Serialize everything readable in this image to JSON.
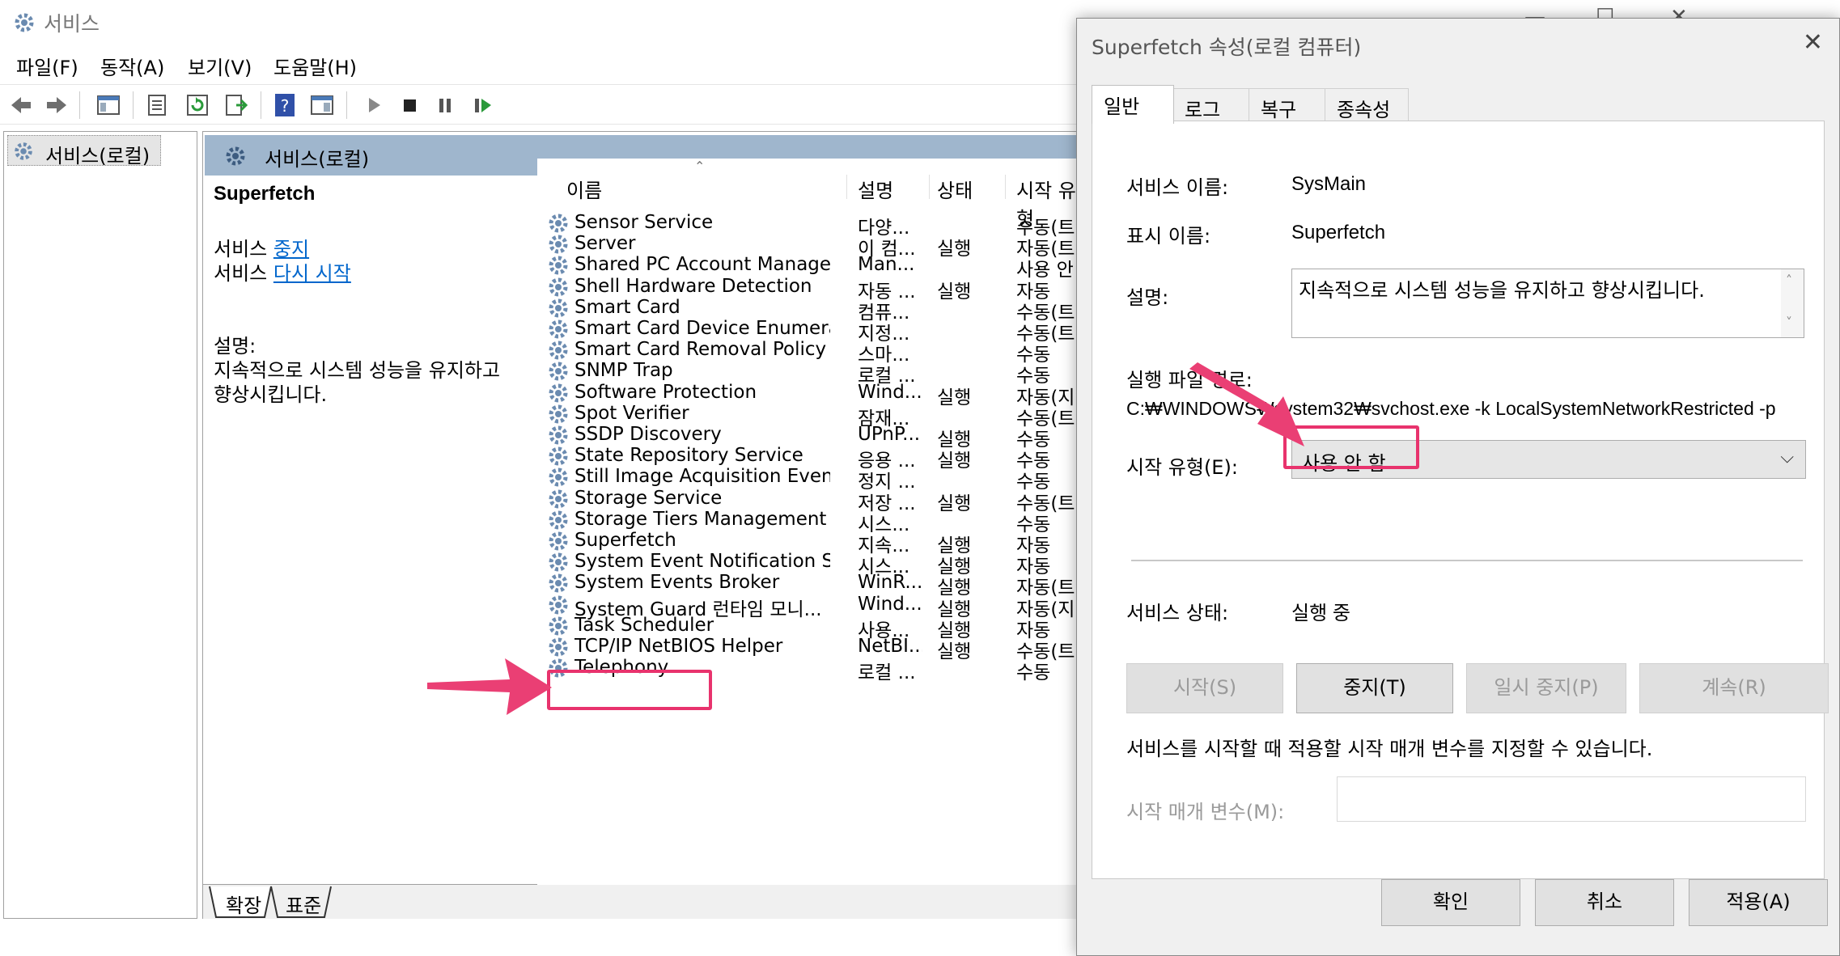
{
  "main_window": {
    "title": "서비스",
    "menu": [
      "파일(F)",
      "동작(A)",
      "보기(V)",
      "도움말(H)"
    ],
    "tree_item": "서비스(로컬)",
    "pane_header": "서비스(로컬)",
    "bottom_tabs": [
      "확장",
      "표준"
    ]
  },
  "detail": {
    "service_name": "Superfetch",
    "action_prefix_1": "서비스",
    "stop_link": "중지",
    "action_prefix_2": "서비스",
    "restart_link": "다시 시작",
    "desc_label": "설명:",
    "desc_line1": "지속적으로 시스템 성능을 유지하고",
    "desc_line2": "향상시킵니다."
  },
  "list": {
    "columns": [
      "이름",
      "설명",
      "상태",
      "시작 유형"
    ],
    "rows": [
      {
        "name": "Sensor Service",
        "desc": "다양...",
        "status": "",
        "start": "수동(트리"
      },
      {
        "name": "Server",
        "desc": "이 컴...",
        "status": "실행",
        "start": "자동(트리"
      },
      {
        "name": "Shared PC Account Manager",
        "desc": "Man...",
        "status": "",
        "start": "사용 안"
      },
      {
        "name": "Shell Hardware Detection",
        "desc": "자동 ...",
        "status": "실행",
        "start": "자동"
      },
      {
        "name": "Smart Card",
        "desc": "컴퓨...",
        "status": "",
        "start": "수동(트리"
      },
      {
        "name": "Smart Card Device Enumera...",
        "desc": "지정...",
        "status": "",
        "start": "수동(트리"
      },
      {
        "name": "Smart Card Removal Policy",
        "desc": "스마...",
        "status": "",
        "start": "수동"
      },
      {
        "name": "SNMP Trap",
        "desc": "로컬 ...",
        "status": "",
        "start": "수동"
      },
      {
        "name": "Software Protection",
        "desc": "Wind...",
        "status": "실행",
        "start": "자동(지연"
      },
      {
        "name": "Spot Verifier",
        "desc": "잠재...",
        "status": "",
        "start": "수동(트리"
      },
      {
        "name": "SSDP Discovery",
        "desc": "UPnP...",
        "status": "실행",
        "start": "수동"
      },
      {
        "name": "State Repository Service",
        "desc": "응용 ...",
        "status": "실행",
        "start": "수동"
      },
      {
        "name": "Still Image Acquisition Events",
        "desc": "정지 ...",
        "status": "",
        "start": "수동"
      },
      {
        "name": "Storage Service",
        "desc": "저장 ...",
        "status": "실행",
        "start": "수동(트리"
      },
      {
        "name": "Storage Tiers Management",
        "desc": "시스...",
        "status": "",
        "start": "수동"
      },
      {
        "name": "Superfetch",
        "desc": "지속...",
        "status": "실행",
        "start": "자동"
      },
      {
        "name": "System Event Notification S...",
        "desc": "시스...",
        "status": "실행",
        "start": "자동"
      },
      {
        "name": "System Events Broker",
        "desc": "WinR...",
        "status": "실행",
        "start": "자동(트리"
      },
      {
        "name": "System Guard 런타임 모니...",
        "desc": "Wind...",
        "status": "실행",
        "start": "자동(지연"
      },
      {
        "name": "Task Scheduler",
        "desc": "사용...",
        "status": "실행",
        "start": "자동"
      },
      {
        "name": "TCP/IP NetBIOS Helper",
        "desc": "NetBI...",
        "status": "실행",
        "start": "수동(트리"
      },
      {
        "name": "Telephony",
        "desc": "로컬 ...",
        "status": "",
        "start": "수동"
      }
    ]
  },
  "dialog": {
    "title": "Superfetch 속성(로컬 컴퓨터)",
    "tabs": [
      "일반",
      "로그온",
      "복구",
      "종속성"
    ],
    "service_name_label": "서비스 이름:",
    "service_name_value": "SysMain",
    "display_name_label": "표시 이름:",
    "display_name_value": "Superfetch",
    "description_label": "설명:",
    "description_value": "지속적으로 시스템 성능을 유지하고 향상시킵니다.",
    "path_label": "실행 파일 경로:",
    "path_value": "C:₩WINDOWS₩system32₩svchost.exe -k LocalSystemNetworkRestricted -p",
    "startup_label": "시작 유형(E):",
    "startup_value": "사용 안 함",
    "status_label": "서비스 상태:",
    "status_value": "실행 중",
    "btn_start": "시작(S)",
    "btn_stop": "중지(T)",
    "btn_pause": "일시 중지(P)",
    "btn_resume": "계속(R)",
    "params_note": "서비스를 시작할 때 적용할 시작 매개 변수를 지정할 수 있습니다.",
    "params_label": "시작 매개 변수(M):",
    "params_value": "",
    "ok": "확인",
    "cancel": "취소",
    "apply": "적용(A)"
  },
  "colors": {
    "highlight": "#e8336d",
    "pane_header": "#9fb6cd",
    "link": "#0066cc"
  }
}
